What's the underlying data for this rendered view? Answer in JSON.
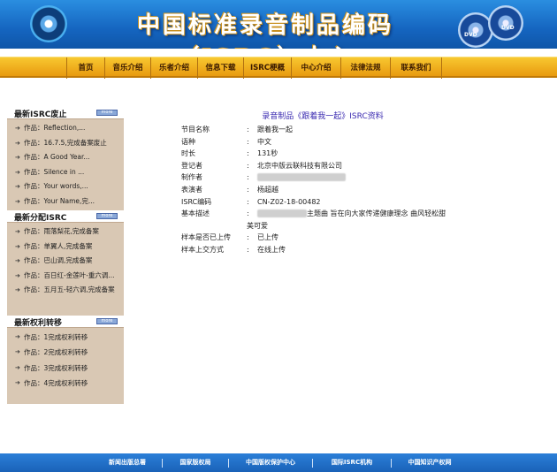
{
  "header": {
    "title": "中国标准录音制品编码（ISRC）中心",
    "dvd_label": "DVD",
    "brand_color": "#1565c0"
  },
  "nav": {
    "items": [
      "首页",
      "音乐介绍",
      "乐者介绍",
      "信息下载",
      "ISRC梗概",
      "中心介绍",
      "法律法规",
      "联系我们"
    ],
    "accent": "#f0b020"
  },
  "sidebar": {
    "more_label": "more",
    "sections": [
      {
        "title": "最新ISRC废止",
        "items": [
          "作品：Reflection,...",
          "作品：16.7.5,完成备案废止",
          "作品：A Good Year...",
          "作品：Silence in ...",
          "作品：Your words,...",
          "作品：Your Name,完..."
        ]
      },
      {
        "title": "最新分配ISRC",
        "items": [
          "作品：雨落梨花,完成备案",
          "作品：单翼人,完成备案",
          "作品：巴山调,完成备案",
          "作品：百日红-金莲叶-重六调...",
          "作品：五月五-轻六调,完成备案"
        ]
      },
      {
        "title": "最新权利转移",
        "items": [
          "作品：1完成权利转移",
          "作品：2完成权利转移",
          "作品：3完成权利转移",
          "作品：4完成权利转移"
        ]
      }
    ]
  },
  "main": {
    "title": "录音制品《跟着我一起》ISRC资料",
    "fields": [
      {
        "label": "节目名称",
        "value": "跟着我一起"
      },
      {
        "label": "语种",
        "value": "中文"
      },
      {
        "label": "时长",
        "value": "131秒"
      },
      {
        "label": "登记者",
        "value": "北京中版云联科技有限公司"
      },
      {
        "label": "制作者",
        "value": ""
      },
      {
        "label": "表演者",
        "value": "杨超越"
      },
      {
        "label": "ISRC编码",
        "value": "CN-Z02-18-00482"
      },
      {
        "label": "基本描述",
        "value": "主题曲 旨在向大家传递健康理念 曲风轻松甜",
        "value2": "美可爱"
      },
      {
        "label": "样本是否已上传",
        "value": "已上传"
      },
      {
        "label": "样本上交方式",
        "value": "在线上传"
      }
    ]
  },
  "footer": {
    "links": [
      "新闻出版总署",
      "国家版权局",
      "中国版权保护中心",
      "国际ISRC机构",
      "中国知识产权网"
    ]
  }
}
